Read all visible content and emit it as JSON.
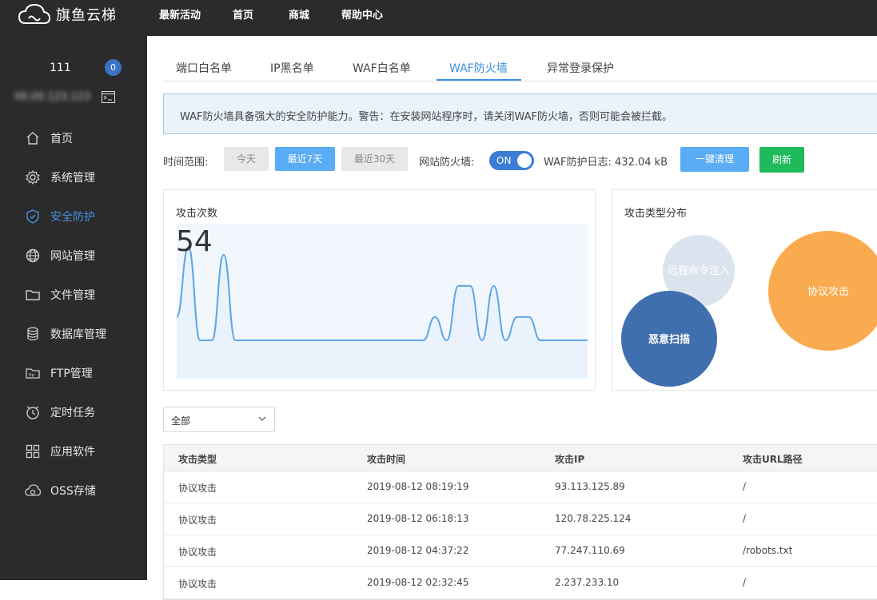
{
  "app": {
    "logo_text": "旗鱼云梯"
  },
  "topnav": [
    "最新活动",
    "首页",
    "商城",
    "帮助中心"
  ],
  "user": {
    "name": "111",
    "notifications": "0",
    "ip": "00.00.123.123"
  },
  "sidebar": {
    "items": [
      {
        "label": "首页",
        "icon": "home-icon",
        "active": false
      },
      {
        "label": "系统管理",
        "icon": "gear-icon",
        "active": false
      },
      {
        "label": "安全防护",
        "icon": "shield-icon",
        "active": true
      },
      {
        "label": "网站管理",
        "icon": "globe-icon",
        "active": false
      },
      {
        "label": "文件管理",
        "icon": "folder-icon",
        "active": false
      },
      {
        "label": "数据库管理",
        "icon": "database-icon",
        "active": false
      },
      {
        "label": "FTP管理",
        "icon": "ftp-icon",
        "active": false
      },
      {
        "label": "定时任务",
        "icon": "clock-icon",
        "active": false
      },
      {
        "label": "应用软件",
        "icon": "apps-icon",
        "active": false
      },
      {
        "label": "OSS存储",
        "icon": "cloud-storage-icon",
        "active": false
      }
    ]
  },
  "tabs": [
    {
      "label": "端口白名单",
      "active": false
    },
    {
      "label": "IP黑名单",
      "active": false
    },
    {
      "label": "WAF白名单",
      "active": false
    },
    {
      "label": "WAF防火墙",
      "active": true
    },
    {
      "label": "异常登录保护",
      "active": false
    }
  ],
  "alert": {
    "text": "WAF防火墙具备强大的安全防护能力。警告：在安装网站程序时，请关闭WAF防火墙，否则可能会被拦截。"
  },
  "filters": {
    "range_label": "时间范围:",
    "range_options": [
      "今天",
      "最近7天",
      "最近30天"
    ],
    "range_selected": "最近7天",
    "firewall_label": "网站防火墙:",
    "firewall_state": "ON",
    "log_label": "WAF防护日志: 432.04 kB",
    "clear_label": "一键清理",
    "refresh_label": "刷新"
  },
  "attack_count": {
    "title": "攻击次数",
    "total": "54",
    "chart_data": {
      "type": "area",
      "series": [
        {
          "values": [
            3,
            12,
            0,
            0,
            11,
            0,
            0,
            0,
            0,
            0,
            0,
            0,
            0,
            0,
            0,
            0,
            0,
            0,
            0,
            0,
            0,
            0,
            3,
            0,
            7,
            7,
            0,
            7,
            0,
            3,
            3,
            0,
            0,
            0,
            0,
            0
          ]
        }
      ],
      "ylim": [
        0,
        15
      ]
    }
  },
  "attack_types": {
    "title": "攻击类型分布",
    "chart_data": {
      "type": "bubble",
      "categories": [
        "远程命令注入",
        "恶意扫描",
        "协议攻击"
      ],
      "values": [
        6,
        10,
        38
      ],
      "colors": [
        "#dbe3ef",
        "#3f6fae",
        "#fbab4f"
      ]
    }
  },
  "type_filter": {
    "selected": "全部"
  },
  "table": {
    "columns": [
      "攻击类型",
      "攻击时间",
      "攻击IP",
      "攻击URL路径"
    ],
    "rows": [
      [
        "协议攻击",
        "2019-08-12 08:19:19",
        "93.113.125.89",
        "/"
      ],
      [
        "协议攻击",
        "2019-08-12 06:18:13",
        "120.78.225.124",
        "/"
      ],
      [
        "协议攻击",
        "2019-08-12 04:37:22",
        "77.247.110.69",
        "/robots.txt"
      ],
      [
        "协议攻击",
        "2019-08-12 02:32:45",
        "2.237.233.10",
        "/"
      ]
    ]
  }
}
